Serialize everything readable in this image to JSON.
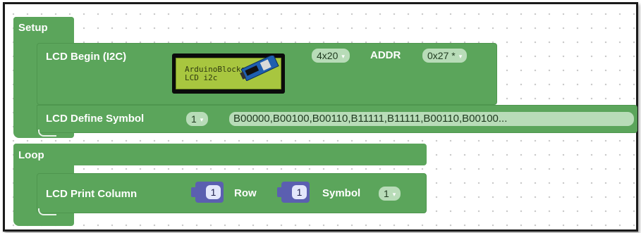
{
  "workspace": {
    "setup": {
      "label": "Setup",
      "lcd_begin": {
        "label": "LCD Begin (I2C)",
        "image_text_line1": "ArduinoBlocks",
        "image_text_line2": "LCD i2c",
        "size_value": "4x20",
        "addr_label": "ADDR",
        "addr_value": "0x27 *"
      },
      "lcd_define_symbol": {
        "label": "LCD Define Symbol",
        "symbol_value": "1",
        "pattern_value": "B00000,B00100,B00110,B11111,B11111,B00110,B00100..."
      }
    },
    "loop": {
      "label": "Loop",
      "lcd_print": {
        "label": "LCD Print  Column",
        "column_value": "1",
        "row_label": "Row",
        "row_value": "1",
        "symbol_label": "Symbol",
        "symbol_value": "1"
      }
    }
  },
  "colors": {
    "block_green": "#5ba55b",
    "field_green": "#b8dcb8",
    "number_block_purple": "#5b5fb0",
    "lcd_screen": "#a8c63f"
  },
  "icons": {
    "dropdown_arrow": "▾",
    "lcd_module_image": "lcd-i2c-module"
  }
}
